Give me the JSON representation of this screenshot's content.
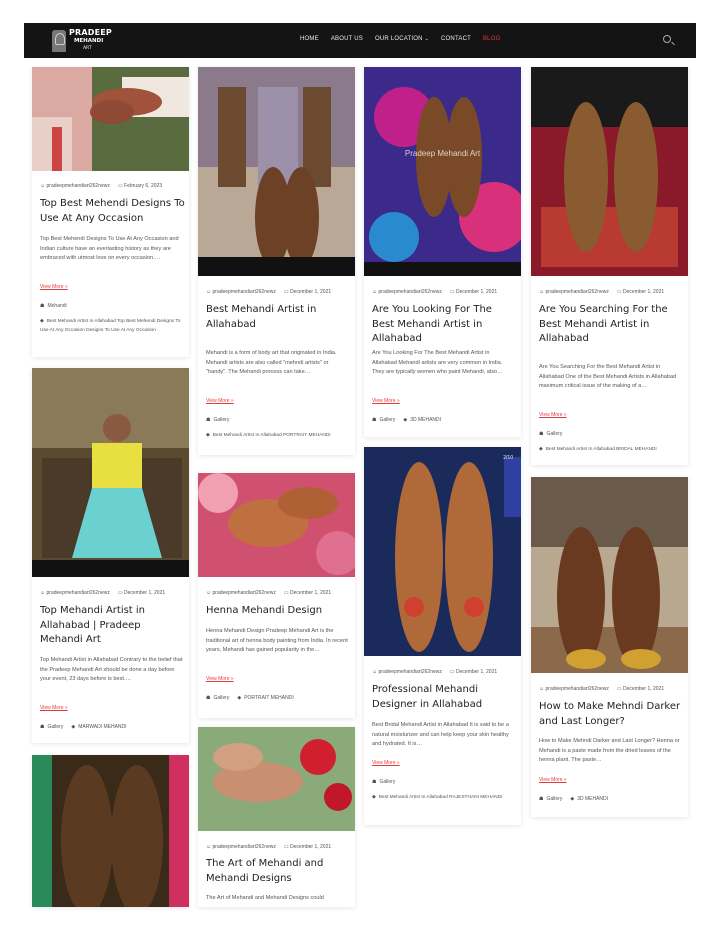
{
  "site": {
    "logo_line1": "PRADEEP",
    "logo_line2": "MEHANDI",
    "logo_line3": "ART"
  },
  "nav": [
    "HOME",
    "ABOUT US",
    "OUR LOCATION",
    "CONTACT",
    "BLOG"
  ],
  "colors": {
    "accent": "#e53a3a",
    "nav_bg": "#141414"
  },
  "cards": [
    {
      "author": "pradeepmehandiart262newz",
      "date": "February 6, 2023",
      "title": "Top Best Mehendi Designs To Use At Any Occasion",
      "excerpt": "Top Best Mehendi Designs To Use At Any Occasion and Indian culture have an everlasting history as they are embraced with utmost love on every occasion.…",
      "more": "View More",
      "category": "Mehandi",
      "tags": "Best Mehandi Artist In Allahabad Top Best Mehendi Designs To Use At Any Occasion Designs To Use At Any Occasion"
    },
    {
      "author": "pradeepmehandiart262newz",
      "date": "December 1, 2021",
      "title": "Best Mehandi Artist in Allahabad",
      "excerpt": "Mehandi is a form of body art that originated in India. Mehandi artists are also called \"mehndi artists\" or \"handy\". The Mehandi process can take…",
      "more": "View More",
      "category": "Gallery",
      "tags": "Best Mehandi Artist In Allahabad PORTRAIT MEHANDI"
    },
    {
      "author": "pradeepmehandiart262newz",
      "date": "December 1, 2021",
      "title": "Are You Looking For The Best Mehandi Artist in Allahabad",
      "excerpt": "Are You Looking For The Best Mehandi Artist in Allahabad Mehandi artists are very common in India. They are typically women who paint Mehandi, also…",
      "more": "View More",
      "category": "Gallery",
      "tags": "3D MEHANDI",
      "watermark": "Pradeep Mehandi Art"
    },
    {
      "author": "pradeepmehandiart262newz",
      "date": "December 1, 2021",
      "title": "Are You Searching For the Best Mehandi Artist in Allahabad",
      "excerpt": "Are You Searching For the Best Mehandi Artist in Allahabad One of the Best Mehandi Artists in Allahabad maximum critical issue of the making of a…",
      "more": "View More",
      "category": "Gallery",
      "tags": "Best Mehandi Artist In Allahabad BRIDAL MEHANDI"
    },
    {
      "author": "pradeepmehandiart262newz",
      "date": "December 1, 2021",
      "title": "Top Mehandi Artist in Allahabad | Pradeep Mehandi Art",
      "excerpt": "Top Mehandi Artist in Allahabad Contrary to the belief that the Pradeep Mehandi Art should be done a day before your event, 23 days before is best.…",
      "more": "View More",
      "category": "Gallery",
      "tags": "MARWADI MEHANDI"
    },
    {
      "author": "pradeepmehandiart262newz",
      "date": "December 1, 2021",
      "title": "Henna Mehandi Design",
      "excerpt": "Henna Mehandi Design Pradeep Mehandi Art is the traditional art of henna body painting from India. In recent years, Mehandi has gained popularity in the…",
      "more": "View More",
      "category": "Gallery",
      "tags": "PORTRAIT MEHANDI"
    },
    {
      "author": "pradeepmehandiart262newz",
      "date": "December 1, 2021",
      "title": "Professional Mehandi Designer in Allahabad",
      "excerpt": "Best Bridal Mehandi Artist in Allahabad It is said to be a natural moisturizer and can help keep your skin healthy and hydrated. It is…",
      "more": "View More",
      "category": "Gallery",
      "tags": "Best Mehandi Artist In Allahabad RAJESTHANI MEHANDI",
      "counter": "2/10"
    },
    {
      "author": "pradeepmehandiart262newz",
      "date": "December 1, 2021",
      "title": "How to Make Mehndi Darker and Last Longer?",
      "excerpt": "How to Make Mehndi Darker and Last Longer? Henna or Mehandi is a paste made from the dried leaves of the henna plant. The paste…",
      "more": "View More",
      "category": "Gallery",
      "tags": "3D MEHANDI"
    },
    {
      "author": "pradeepmehandiart262newz",
      "date": "December 1, 2021",
      "title": "The Art of Mehandi and Mehandi Designs",
      "excerpt": "The Art of Mehandi and Mehandi Designs could"
    }
  ]
}
